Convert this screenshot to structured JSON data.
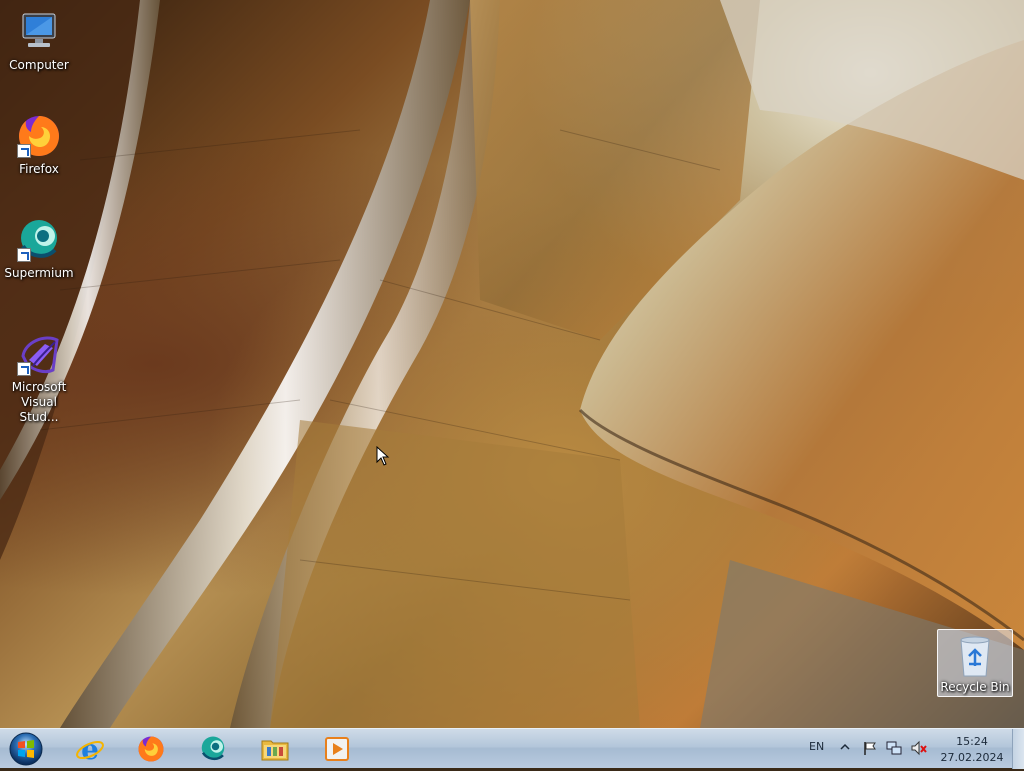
{
  "desktop": {
    "icons": [
      {
        "label_line1": "Computer",
        "label_line2": "",
        "icon": "computer-icon"
      },
      {
        "label_line1": "Firefox",
        "label_line2": "",
        "icon": "firefox-icon"
      },
      {
        "label_line1": "Supermium",
        "label_line2": "",
        "icon": "supermium-icon"
      },
      {
        "label_line1": "Microsoft",
        "label_line2": "Visual Stud...",
        "icon": "visual-studio-icon"
      }
    ],
    "recycle_bin": {
      "label": "Recycle Bin",
      "icon": "recycle-bin-icon"
    }
  },
  "taskbar": {
    "start_icon": "windows-start-icon",
    "pinned": [
      {
        "name": "internet-explorer",
        "icon": "internet-explorer-icon"
      },
      {
        "name": "firefox",
        "icon": "firefox-icon"
      },
      {
        "name": "supermium",
        "icon": "supermium-icon"
      },
      {
        "name": "file-explorer",
        "icon": "folder-icon"
      },
      {
        "name": "media-player",
        "icon": "media-player-icon"
      }
    ],
    "tray": {
      "language": "EN",
      "time": "15:24",
      "date": "27.02.2024",
      "icons": [
        "show-hidden-icons-icon",
        "action-center-flag-icon",
        "network-icon",
        "volume-muted-icon"
      ]
    }
  },
  "colors": {
    "taskbar_top": "#cfdbe8",
    "taskbar_bottom": "#b9cbe0",
    "selection": "#dce6f5"
  }
}
